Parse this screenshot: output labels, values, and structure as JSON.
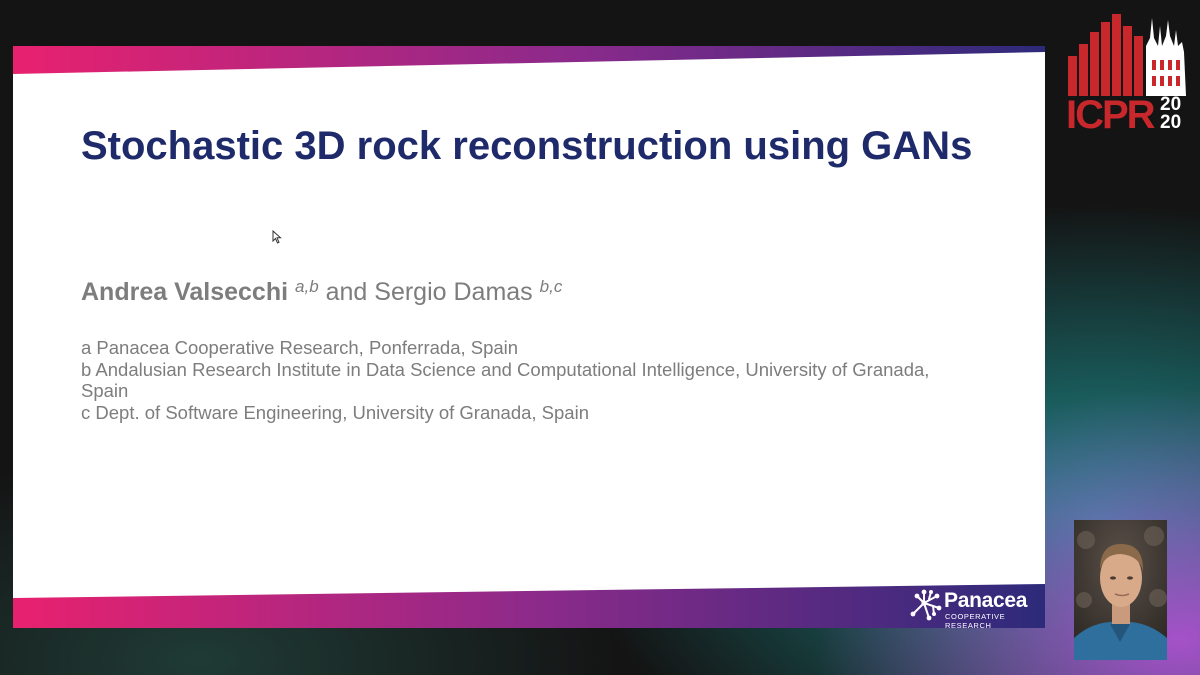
{
  "slide": {
    "title": "Stochastic 3D rock reconstruction using GANs",
    "author1": "Andrea Valsecchi",
    "author1_sup": "a,b",
    "author_joiner": "and",
    "author2": "Sergio Damas",
    "author2_sup": "b,c",
    "affiliations": [
      "a Panacea Cooperative Research, Ponferrada, Spain",
      "b Andalusian Research Institute in Data Science and Computational Intelligence, University of Granada, Spain",
      "c Dept. of Software Engineering, University of Granada, Spain"
    ]
  },
  "branding": {
    "company_name": "Panacea",
    "company_subtitle": "COOPERATIVE RESEARCH",
    "conference": "ICPR",
    "conference_year_top": "20",
    "conference_year_bottom": "20"
  },
  "colors": {
    "title": "#1f2a6b",
    "band_start": "#e8216f",
    "band_end": "#2d2a7a",
    "conference_red": "#c8282c"
  },
  "icons": {
    "cursor": "mouse-cursor-icon",
    "company_logo": "panacea-network-icon",
    "webcam": "presenter-webcam"
  }
}
